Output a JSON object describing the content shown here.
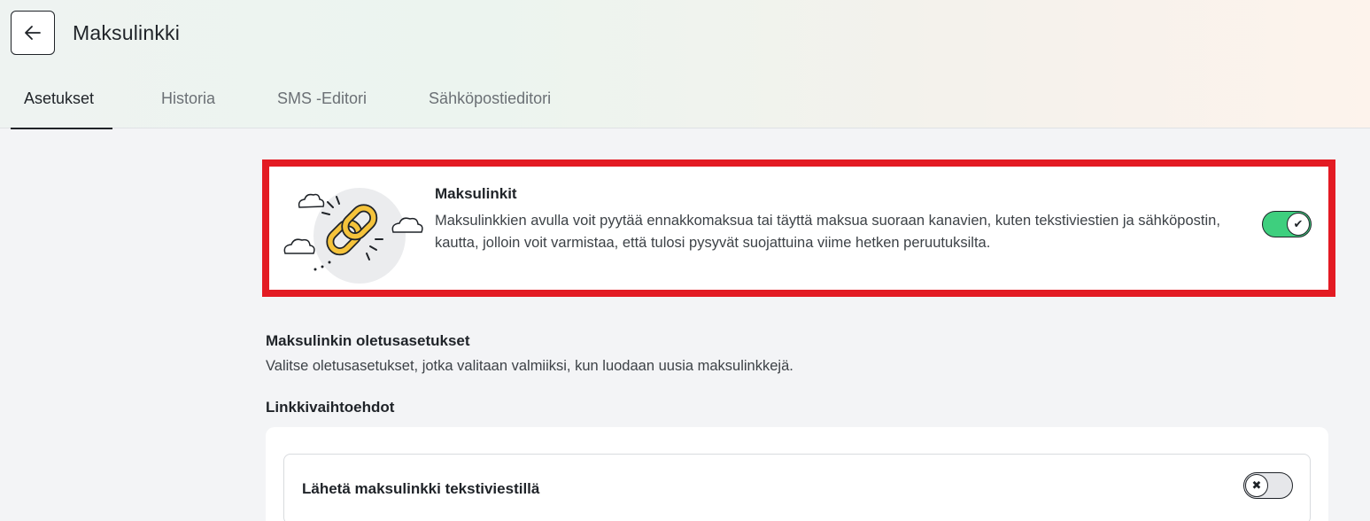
{
  "header": {
    "title": "Maksulinkki",
    "back_icon": "arrow-left-icon",
    "tabs": [
      {
        "label": "Asetukset",
        "active": true
      },
      {
        "label": "Historia",
        "active": false
      },
      {
        "label": "SMS -Editori",
        "active": false
      },
      {
        "label": "Sähköpostieditori",
        "active": false
      }
    ]
  },
  "hero": {
    "title": "Maksulinkit",
    "description": "Maksulinkkien avulla voit pyytää ennakkomaksua tai täyttä maksua suoraan kanavien, kuten tekstiviestien ja sähköpostin, kautta, jolloin voit varmistaa, että tulosi pysyvät suojattuina viime hetken peruutuksilta.",
    "illustration_icon": "chain-link-icon",
    "toggle_on": true,
    "toggle_symbol": "✔"
  },
  "defaults": {
    "title": "Maksulinkin oletusasetukset",
    "description": "Valitse oletusasetukset, jotka valitaan valmiiksi, kun luodaan uusia maksulinkkejä."
  },
  "link_options": {
    "title": "Linkkivaihtoehdot",
    "items": [
      {
        "label": "Lähetä maksulinkki tekstiviestillä",
        "toggle_on": false,
        "toggle_symbol": "✖"
      }
    ]
  },
  "colors": {
    "accent_green": "#3ecf7e",
    "highlight_red": "#e31b23",
    "chain_yellow": "#f5c33b"
  }
}
